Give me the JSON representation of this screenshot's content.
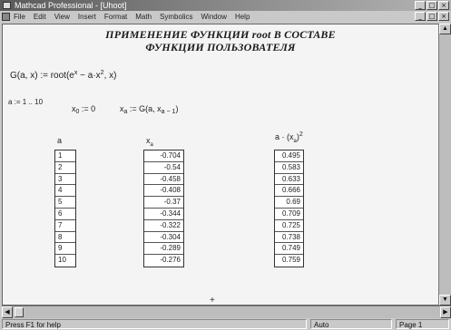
{
  "window": {
    "title": "Mathcad Professional - [Uhoot]",
    "buttons": [
      "_",
      "□",
      "×"
    ]
  },
  "menu": {
    "items": [
      "File",
      "Edit",
      "View",
      "Insert",
      "Format",
      "Math",
      "Symbolics",
      "Window",
      "Help"
    ]
  },
  "worksheet": {
    "heading_line1": "ПРИМЕНЕНИЕ ФУНКЦИИ root В СОСТАВЕ",
    "heading_line2": "ФУНКЦИИ ПОЛЬЗОВАТЕЛЯ",
    "def_lhs": "G(a, x) := root(e",
    "def_exp": "x",
    "def_mid": " − a·x",
    "def_pow": "2",
    "def_end": ", x)",
    "range_def": "a := 1 .. 10",
    "x0_name": "x",
    "x0_sub": "0",
    "x0_val": " := 0",
    "xa_name": "x",
    "xa_sub": "a",
    "xa_rhs": " := G(a, x",
    "xa_rhs_sub": "a − 1",
    "xa_close": ")",
    "col_a": "a",
    "col_x": "x",
    "col_x_sub": "a",
    "col_f_pre": "a · (x",
    "col_f_sub": "a",
    "col_f_post": ")",
    "col_f_pow": "2",
    "a_values": [
      "1",
      "2",
      "3",
      "4",
      "5",
      "6",
      "7",
      "8",
      "9",
      "10"
    ],
    "x_values": [
      "-0.704",
      "-0.54",
      "-0.458",
      "-0.408",
      "-0.37",
      "-0.344",
      "-0.322",
      "-0.304",
      "-0.289",
      "-0.276"
    ],
    "f_values": [
      "0.495",
      "0.583",
      "0.633",
      "0.666",
      "0.69",
      "0.709",
      "0.725",
      "0.738",
      "0.749",
      "0.759"
    ]
  },
  "status": {
    "help": "Press F1 for help",
    "mode": "Auto",
    "page": "Page 1"
  }
}
